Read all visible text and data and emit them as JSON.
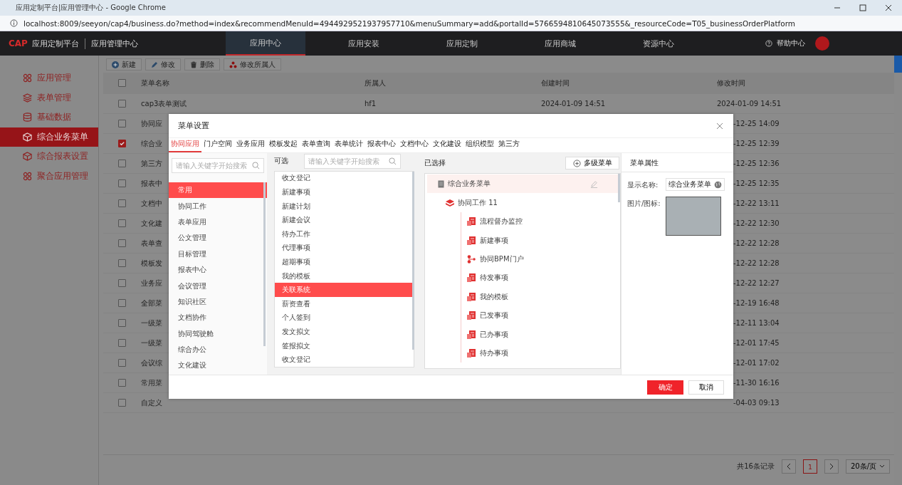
{
  "browser": {
    "title": "应用定制平台|应用管理中心 - Google Chrome",
    "url": "localhost:8009/seeyon/cap4/business.do?method=index&recommendMenuId=4944929521937957710&menuSummary=add&portalId=5766594810645073555&_resourceCode=T05_businessOrderPlatform"
  },
  "header": {
    "logo": "CAP",
    "platform": "应用定制平台",
    "section": "应用管理中心",
    "help": "帮助中心",
    "nav": [
      {
        "label": "应用中心",
        "selected": true
      },
      {
        "label": "应用安装",
        "selected": false
      },
      {
        "label": "应用定制",
        "selected": false
      },
      {
        "label": "应用商城",
        "selected": false
      },
      {
        "label": "资源中心",
        "selected": false
      }
    ]
  },
  "sidebar": {
    "items": [
      {
        "label": "应用管理",
        "selected": false
      },
      {
        "label": "表单管理",
        "selected": false
      },
      {
        "label": "基础数据",
        "selected": false
      },
      {
        "label": "综合业务菜单",
        "selected": true
      },
      {
        "label": "综合报表设置",
        "selected": false
      },
      {
        "label": "聚合应用管理",
        "selected": false
      }
    ]
  },
  "toolbar": [
    "新建",
    "修改",
    "删除",
    "修改所属人"
  ],
  "table": {
    "columns": [
      "菜单名称",
      "所属人",
      "创建时间",
      "修改时间"
    ],
    "header_checked": false,
    "rows": [
      {
        "checked": false,
        "name": "cap3表单测试",
        "owner": "hf1",
        "created": "2024-01-09 14:51",
        "modified": "2024-01-09 14:51"
      },
      {
        "checked": false,
        "name": "协同应",
        "modified": "-12-25 14:09"
      },
      {
        "checked": true,
        "name": "综合业",
        "modified": "-12-25 12:39"
      },
      {
        "checked": false,
        "name": "第三方",
        "modified": "-12-25 12:36"
      },
      {
        "checked": false,
        "name": "报表中",
        "modified": "-12-25 12:35"
      },
      {
        "checked": false,
        "name": "文档中",
        "modified": "-12-22 13:11"
      },
      {
        "checked": false,
        "name": "文化建",
        "modified": "-12-22 12:30"
      },
      {
        "checked": false,
        "name": "表单查",
        "modified": "-12-22 12:28"
      },
      {
        "checked": false,
        "name": "模板发",
        "modified": "-12-22 12:28"
      },
      {
        "checked": false,
        "name": "业务应",
        "modified": "-12-22 12:27"
      },
      {
        "checked": false,
        "name": "全部菜",
        "modified": "-12-19 16:48"
      },
      {
        "checked": false,
        "name": "一级菜",
        "modified": "-12-11 13:04"
      },
      {
        "checked": false,
        "name": "一级菜",
        "modified": "-12-01 17:45"
      },
      {
        "checked": false,
        "name": "会议综",
        "modified": "-12-01 17:02"
      },
      {
        "checked": false,
        "name": "常用菜",
        "modified": "-11-30 16:16"
      },
      {
        "checked": false,
        "name": "自定义",
        "modified": "-04-03 09:13"
      }
    ]
  },
  "pagination": {
    "total": "共16条记录",
    "page": "1",
    "page_size": "20条/页"
  },
  "dialog": {
    "title": "菜单设置",
    "tabs": [
      {
        "label": "协同应用",
        "selected": true
      },
      {
        "label": "门户空间",
        "selected": false
      },
      {
        "label": "业务应用",
        "selected": false
      },
      {
        "label": "模板发起",
        "selected": false
      },
      {
        "label": "表单查询",
        "selected": false
      },
      {
        "label": "表单统计",
        "selected": false
      },
      {
        "label": "报表中心",
        "selected": false
      },
      {
        "label": "文档中心",
        "selected": false
      },
      {
        "label": "文化建设",
        "selected": false
      },
      {
        "label": "组织模型",
        "selected": false
      },
      {
        "label": "第三方",
        "selected": false
      }
    ],
    "category_search": {
      "placeholder": "请输入关键字开始搜索"
    },
    "categories": [
      {
        "label": "常用",
        "selected": true
      },
      {
        "label": "协同工作",
        "selected": false
      },
      {
        "label": "表单应用",
        "selected": false
      },
      {
        "label": "公文管理",
        "selected": false
      },
      {
        "label": "目标管理",
        "selected": false
      },
      {
        "label": "报表中心",
        "selected": false
      },
      {
        "label": "会议管理",
        "selected": false
      },
      {
        "label": "知识社区",
        "selected": false
      },
      {
        "label": "文档协作",
        "selected": false
      },
      {
        "label": "协同驾驶舱",
        "selected": false
      },
      {
        "label": "综合办公",
        "selected": false
      },
      {
        "label": "文化建设",
        "selected": false
      }
    ],
    "available": {
      "label": "可选",
      "placeholder": "请输入关键字开始搜索",
      "items": [
        {
          "label": "收文登记",
          "selected": false
        },
        {
          "label": "新建事项",
          "selected": false
        },
        {
          "label": "新建计划",
          "selected": false
        },
        {
          "label": "新建会议",
          "selected": false
        },
        {
          "label": "待办工作",
          "selected": false
        },
        {
          "label": "代理事项",
          "selected": false
        },
        {
          "label": "超期事项",
          "selected": false
        },
        {
          "label": "我的模板",
          "selected": false
        },
        {
          "label": "关联系统",
          "selected": true
        },
        {
          "label": "薪资查看",
          "selected": false
        },
        {
          "label": "个人签到",
          "selected": false
        },
        {
          "label": "发文拟文",
          "selected": false
        },
        {
          "label": "签报拟文",
          "selected": false
        },
        {
          "label": "收文登记",
          "selected": false
        }
      ]
    },
    "chosen": {
      "label": "已选择",
      "add_button": "多级菜单",
      "tree": {
        "label": "综合业务菜单",
        "children": [
          {
            "label": "协同工作 11",
            "children": [
              {
                "label": "流程督办监控",
                "kind": "app"
              },
              {
                "label": "新建事项",
                "kind": "app"
              },
              {
                "label": "协同BPM门户",
                "kind": "bpm"
              },
              {
                "label": "待发事项",
                "kind": "app"
              },
              {
                "label": "我的模板",
                "kind": "app"
              },
              {
                "label": "已发事项",
                "kind": "app"
              },
              {
                "label": "已办事项",
                "kind": "app"
              },
              {
                "label": "待办事项",
                "kind": "app"
              }
            ]
          }
        ]
      }
    },
    "properties": {
      "title": "菜单属性",
      "name_label": "显示名称:",
      "name_value": "综合业务菜单",
      "image_label": "图片/图标:"
    },
    "buttons": {
      "ok": "确定",
      "cancel": "取消"
    }
  }
}
